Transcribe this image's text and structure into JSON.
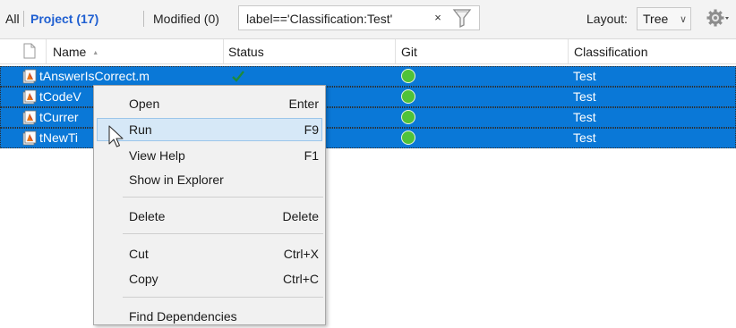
{
  "toolbar": {
    "tab_all": "All",
    "tab_project": "Project (17)",
    "tab_modified": "Modified (0)",
    "filter_value": "label=='Classification:Test'",
    "clear_symbol": "×",
    "layout_label": "Layout:",
    "layout_value": "Tree"
  },
  "table": {
    "columns": [
      "Name",
      "Status",
      "Git",
      "Classification"
    ],
    "sort_indicator": "▲",
    "rows": [
      {
        "name": "tAnswerIsCorrect.m",
        "status": "ok",
        "git": "green",
        "classification": "Test"
      },
      {
        "name": "tCodeV",
        "status": "",
        "git": "green",
        "classification": "Test"
      },
      {
        "name": "tCurrer",
        "status": "",
        "git": "green",
        "classification": "Test"
      },
      {
        "name": "tNewTi",
        "status": "",
        "git": "green",
        "classification": "Test"
      }
    ]
  },
  "context_menu": {
    "items": [
      {
        "label": "Open",
        "shortcut": "Enter"
      },
      {
        "label": "Run",
        "shortcut": "F9"
      },
      {
        "label": "View Help",
        "shortcut": "F1"
      },
      {
        "label": "Show in Explorer",
        "shortcut": ""
      },
      {
        "label": "Delete",
        "shortcut": "Delete"
      },
      {
        "label": "Cut",
        "shortcut": "Ctrl+X"
      },
      {
        "label": "Copy",
        "shortcut": "Ctrl+C"
      },
      {
        "label": "Find Dependencies",
        "shortcut": ""
      }
    ],
    "hovered_item": "Run"
  },
  "colors": {
    "selection": "#0a78d7",
    "project_tab": "#1f5fd1",
    "git_ok": "#4fc23a",
    "menu_hover": "#d6e8f7"
  },
  "icons": {
    "filter": "funnel-icon",
    "settings": "gear-icon",
    "file": "script-file-icon",
    "status": "check-icon",
    "git": "green-dot-icon",
    "pointer": "mouse-cursor-icon"
  }
}
